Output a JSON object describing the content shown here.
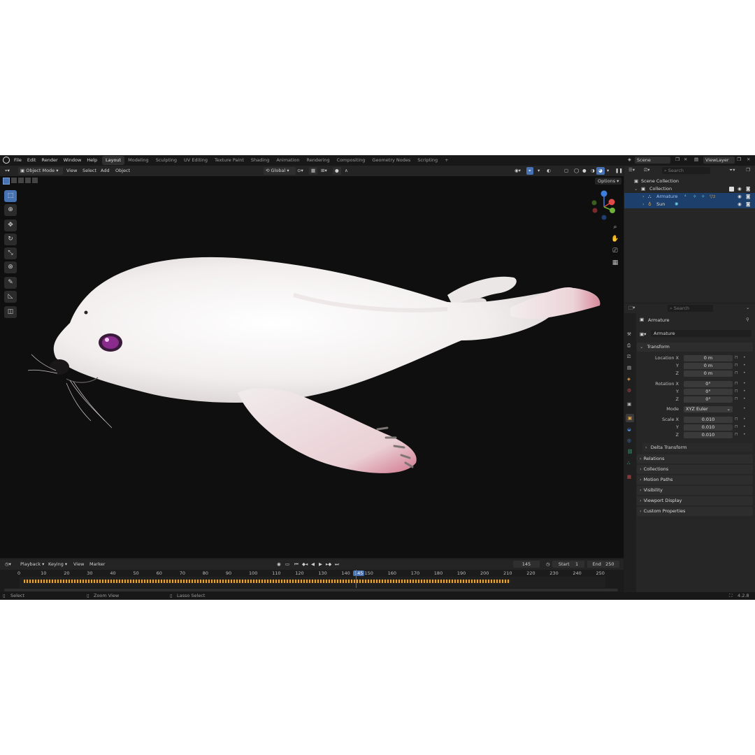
{
  "menu": [
    "File",
    "Edit",
    "Render",
    "Window",
    "Help"
  ],
  "workspaces": [
    "Layout",
    "Modeling",
    "Sculpting",
    "UV Editing",
    "Texture Paint",
    "Shading",
    "Animation",
    "Rendering",
    "Compositing",
    "Geometry Nodes",
    "Scripting"
  ],
  "active_workspace": "Layout",
  "scene": "Scene",
  "view_layer": "ViewLayer",
  "header": {
    "mode": "Object Mode",
    "view": "View",
    "select": "Select",
    "add": "Add",
    "object": "Object",
    "orientation": "Global",
    "options": "Options"
  },
  "outliner": {
    "search_placeholder": "Search",
    "scene_collection": "Scene Collection",
    "collection": "Collection",
    "items": [
      "Armature",
      "Sun"
    ],
    "armature_badge": "2"
  },
  "properties": {
    "search_placeholder": "Search",
    "object_name": "Armature",
    "data_name": "Armature",
    "transform": "Transform",
    "location_label": "Location X",
    "rotation_label": "Rotation X",
    "scale_label": "Scale X",
    "y": "Y",
    "z": "Z",
    "location": [
      "0 m",
      "0 m",
      "0 m"
    ],
    "rotation": [
      "0°",
      "0°",
      "0°"
    ],
    "mode_label": "Mode",
    "mode_value": "XYZ Euler",
    "scale": [
      "0.010",
      "0.010",
      "0.010"
    ],
    "delta_transform": "Delta Transform",
    "panels": [
      "Relations",
      "Collections",
      "Motion Paths",
      "Visibility",
      "Viewport Display",
      "Custom Properties"
    ]
  },
  "timeline": {
    "playback": "Playback",
    "keying": "Keying",
    "view": "View",
    "marker": "Marker",
    "current_frame": "145",
    "start_label": "Start",
    "start": "1",
    "end_label": "End",
    "end": "250",
    "ticks": [
      "0",
      "10",
      "20",
      "30",
      "40",
      "50",
      "60",
      "70",
      "80",
      "90",
      "100",
      "110",
      "120",
      "130",
      "140",
      "145",
      "150",
      "160",
      "170",
      "180",
      "190",
      "200",
      "210",
      "220",
      "230",
      "240",
      "250"
    ]
  },
  "status": {
    "select": "Select",
    "zoom": "Zoom View",
    "lasso": "Lasso Select",
    "version": "4.2.8"
  },
  "colors": {
    "accent": "#4772b3",
    "selection": "#1c3f6b",
    "keyframe": "#e8a33c"
  }
}
